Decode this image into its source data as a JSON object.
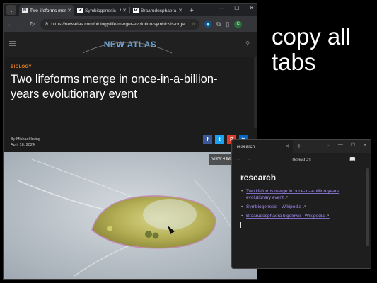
{
  "browser": {
    "tabs": [
      {
        "title": "Two lifeforms merg",
        "favicon": "N",
        "active": true
      },
      {
        "title": "Symbiogenesis - Wi",
        "favicon": "W",
        "active": false
      },
      {
        "title": "Braarudosphaera bi",
        "favicon": "W",
        "active": false
      }
    ],
    "new_tab": "+",
    "url": "https://newatlas.com/biology/life-merger-evolution-symbiosis-orga..."
  },
  "article": {
    "site_logo": "NEW ATLAS",
    "category": "BIOLOGY",
    "headline": "Two lifeforms merge in once-in-a-billion-years evolutionary event",
    "author": "By Michael Irving",
    "date": "April 18, 2024",
    "share": [
      {
        "label": "f",
        "color": "#3b5998"
      },
      {
        "label": "t",
        "color": "#1da1f2"
      },
      {
        "label": "P",
        "color": "#e03c2e"
      },
      {
        "label": "in",
        "color": "#0a66c2"
      }
    ],
    "view_images": "VIEW 4 IMAGES"
  },
  "obsidian": {
    "tab_title": "research",
    "breadcrumb": "research",
    "heading": "research",
    "links": [
      "Two lifeforms merge in once-in-a-billion-years evolutionary event",
      "Symbiogenesis - Wikipedia",
      "Braarudosphaera bigelowii - Wikipedia"
    ]
  },
  "caption": {
    "line1": "copy all",
    "line2": "tabs"
  }
}
